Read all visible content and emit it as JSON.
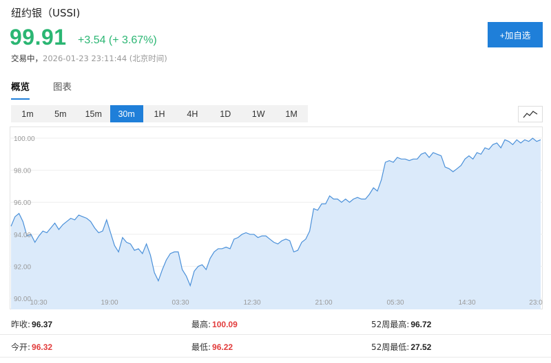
{
  "header": {
    "title": "纽约银（USSI)",
    "price": "99.91",
    "change": "+3.54 (+ 3.67%)",
    "status_label": "交易中，",
    "timestamp": "2026-01-23 23:11:44",
    "tz": "(北京时间)",
    "add_label": "+加自选"
  },
  "tabs": [
    {
      "label": "概览",
      "active": true
    },
    {
      "label": "图表",
      "active": false
    }
  ],
  "periods": [
    {
      "label": "1m",
      "active": false
    },
    {
      "label": "5m",
      "active": false
    },
    {
      "label": "15m",
      "active": false
    },
    {
      "label": "30m",
      "active": true
    },
    {
      "label": "1H",
      "active": false
    },
    {
      "label": "4H",
      "active": false
    },
    {
      "label": "1D",
      "active": false
    },
    {
      "label": "1W",
      "active": false
    },
    {
      "label": "1M",
      "active": false
    }
  ],
  "icons": {
    "chart_type": "line-chart-icon"
  },
  "colors": {
    "up": "#2bb673",
    "accent": "#1f7fd9",
    "line": "#4a90d9",
    "fill": "#dbeafa",
    "down_value": "#e23b3b"
  },
  "chart_data": {
    "type": "area",
    "x_ticks": [
      "10:30",
      "19:00",
      "03:30",
      "12:30",
      "21:00",
      "05:30",
      "14:30",
      "23:0"
    ],
    "y_ticks": [
      "90.00",
      "92.00",
      "94.00",
      "96.00",
      "98.00",
      "100.00"
    ],
    "ylim": [
      90,
      100
    ],
    "x": [
      0,
      2,
      4,
      6,
      8,
      10,
      12,
      14,
      16,
      18,
      20,
      22,
      24,
      26,
      28,
      30,
      32,
      34,
      36,
      38,
      40,
      42,
      44,
      46,
      48,
      50,
      52,
      54,
      56,
      58,
      60,
      62,
      64,
      66,
      68,
      70,
      72,
      74,
      76,
      78,
      80,
      82,
      84,
      86,
      88,
      90,
      92,
      94,
      96,
      98,
      100,
      102,
      104,
      106,
      108,
      110,
      112,
      114,
      116,
      118,
      120,
      122,
      124,
      126,
      128,
      130,
      132,
      134,
      136,
      138,
      140,
      142,
      144,
      146,
      148,
      150,
      152,
      154,
      156,
      158,
      160,
      162,
      164,
      166,
      168,
      170,
      172,
      174,
      176,
      178,
      180,
      182,
      184,
      186,
      188,
      190,
      192,
      194,
      196,
      198,
      200,
      202,
      204,
      206,
      208,
      210,
      212,
      214,
      216,
      218,
      220,
      222,
      224,
      226,
      228,
      230,
      232,
      234,
      236,
      238,
      240,
      242,
      244,
      246,
      248,
      250,
      252,
      254,
      256,
      258,
      260,
      262,
      264,
      266
    ],
    "values": [
      94.5,
      95.1,
      95.3,
      94.8,
      93.9,
      94.0,
      93.5,
      93.9,
      94.2,
      94.1,
      94.4,
      94.7,
      94.3,
      94.6,
      94.8,
      95.0,
      94.9,
      95.2,
      95.1,
      95.0,
      94.8,
      94.4,
      94.1,
      94.2,
      94.9,
      94.1,
      93.3,
      92.9,
      93.8,
      93.5,
      93.4,
      93.0,
      93.1,
      92.8,
      93.4,
      92.7,
      91.6,
      91.1,
      91.8,
      92.4,
      92.8,
      92.9,
      92.9,
      91.8,
      91.4,
      90.8,
      91.7,
      92.0,
      92.1,
      91.8,
      92.5,
      92.9,
      93.1,
      93.1,
      93.2,
      93.1,
      93.7,
      93.8,
      94.0,
      94.1,
      94.0,
      94.0,
      93.8,
      93.9,
      93.9,
      93.7,
      93.5,
      93.4,
      93.6,
      93.7,
      93.6,
      92.9,
      93.0,
      93.5,
      93.7,
      94.2,
      95.6,
      95.5,
      95.9,
      95.9,
      96.4,
      96.2,
      96.2,
      96.0,
      96.2,
      96.0,
      96.2,
      96.3,
      96.2,
      96.2,
      96.5,
      96.9,
      96.7,
      97.4,
      98.5,
      98.6,
      98.5,
      98.8,
      98.7,
      98.7,
      98.6,
      98.7,
      98.7,
      99.0,
      99.1,
      98.8,
      99.1,
      99.0,
      98.9,
      98.2,
      98.1,
      97.9,
      98.1,
      98.3,
      98.7,
      98.9,
      98.7,
      99.1,
      99.0,
      99.4,
      99.3,
      99.6,
      99.7,
      99.4,
      99.9,
      99.8,
      99.6,
      99.9,
      99.7,
      99.9,
      99.8,
      100.0,
      99.8,
      99.9
    ]
  },
  "stats": [
    [
      {
        "label": "昨收:",
        "value": "96.37",
        "color": "dark"
      },
      {
        "label": "最高:",
        "value": "100.09",
        "color": "red"
      },
      {
        "label": "52周最高:",
        "value": "96.72",
        "color": "dark"
      }
    ],
    [
      {
        "label": "今开:",
        "value": "96.32",
        "color": "red"
      },
      {
        "label": "最低:",
        "value": "96.22",
        "color": "red"
      },
      {
        "label": "52周最低:",
        "value": "27.52",
        "color": "dark"
      }
    ]
  ]
}
